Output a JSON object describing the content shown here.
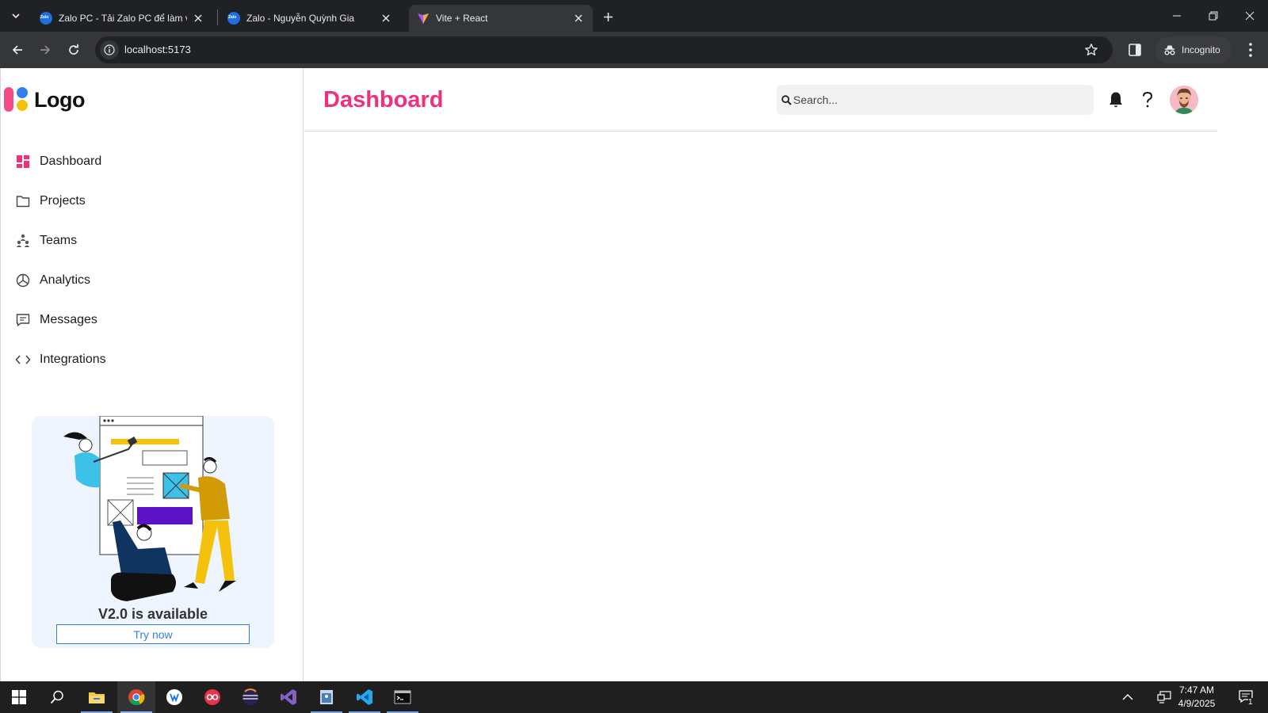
{
  "browser": {
    "tabs": [
      {
        "title": "Zalo PC - Tải Zalo PC để làm việc",
        "active": false
      },
      {
        "title": "Zalo - Nguyễn Quỳnh Gia",
        "active": false
      },
      {
        "title": "Vite + React",
        "active": true
      }
    ],
    "url": "localhost:5173",
    "incognito_label": "Incognito"
  },
  "sidebar": {
    "logo_text": "Logo",
    "items": [
      {
        "label": "Dashboard",
        "icon": "dashboard-icon",
        "active": true
      },
      {
        "label": "Projects",
        "icon": "folder-icon"
      },
      {
        "label": "Teams",
        "icon": "teams-icon"
      },
      {
        "label": "Analytics",
        "icon": "pie-chart-icon"
      },
      {
        "label": "Messages",
        "icon": "message-icon"
      },
      {
        "label": "Integrations",
        "icon": "code-icon"
      }
    ],
    "promo": {
      "title": "V2.0 is available",
      "button_label": "Try now"
    }
  },
  "header": {
    "title": "Dashboard",
    "search_placeholder": "Search..."
  },
  "taskbar": {
    "time": "7:47 AM",
    "date": "4/9/2025",
    "notification_count": "1"
  },
  "colors": {
    "accent_pink": "#f0307a",
    "accent_blue": "#2f80ed",
    "logo_yellow": "#f4c20d"
  }
}
